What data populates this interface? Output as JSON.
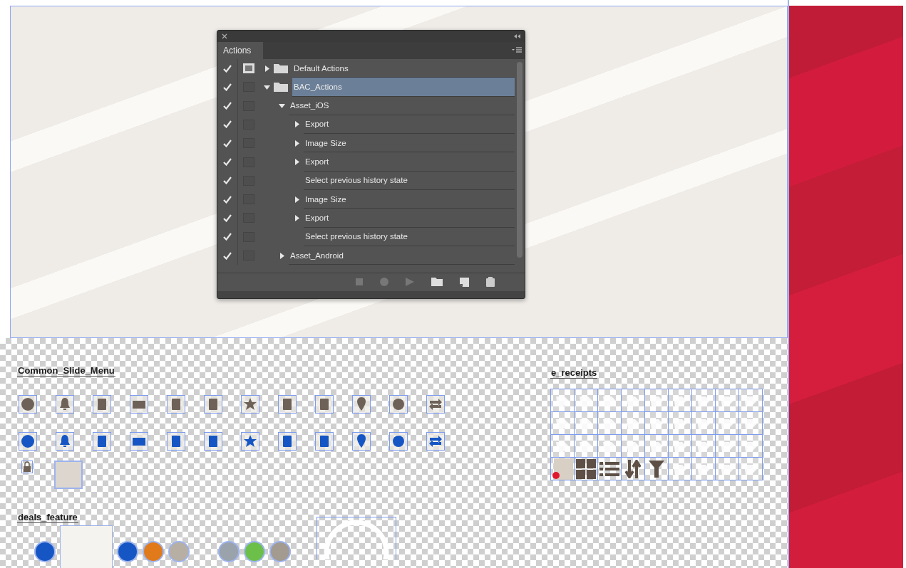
{
  "actions_panel": {
    "tab": "Actions",
    "items": [
      {
        "kind": "set",
        "label": "Default Actions",
        "checked": true,
        "dialog": true,
        "expanded": false,
        "selected": false
      },
      {
        "kind": "set",
        "label": "BAC_Actions",
        "checked": true,
        "dialog": false,
        "expanded": true,
        "selected": true,
        "children": [
          {
            "kind": "action",
            "label": "Asset_iOS",
            "checked": true,
            "dialog": false,
            "expanded": true,
            "selected": false,
            "children": [
              {
                "kind": "command",
                "label": "Export",
                "checked": true,
                "dialog": false,
                "expanded": false,
                "selected": false
              },
              {
                "kind": "command",
                "label": "Image Size",
                "checked": true,
                "dialog": false,
                "expanded": false,
                "selected": false
              },
              {
                "kind": "command",
                "label": "Export",
                "checked": true,
                "dialog": false,
                "expanded": false,
                "selected": false
              },
              {
                "kind": "step",
                "label": "Select previous history state",
                "checked": true,
                "dialog": false,
                "selected": false
              },
              {
                "kind": "command",
                "label": "Image Size",
                "checked": true,
                "dialog": false,
                "expanded": false,
                "selected": false
              },
              {
                "kind": "command",
                "label": "Export",
                "checked": true,
                "dialog": false,
                "expanded": false,
                "selected": false
              },
              {
                "kind": "step",
                "label": "Select previous history state",
                "checked": true,
                "dialog": false,
                "selected": false
              }
            ]
          },
          {
            "kind": "action",
            "label": "Asset_Android",
            "checked": true,
            "dialog": false,
            "expanded": false,
            "selected": false
          }
        ]
      }
    ]
  },
  "canvas": {
    "common_slide_menu": {
      "title": "Common_Slide_Menu",
      "icon_rows": [
        {
          "color": "#6e6258"
        },
        {
          "color": "#1656c4"
        }
      ]
    },
    "deals_feature": {
      "title": "deals_feature"
    },
    "e_receipts": {
      "title": "e_receipts"
    }
  }
}
